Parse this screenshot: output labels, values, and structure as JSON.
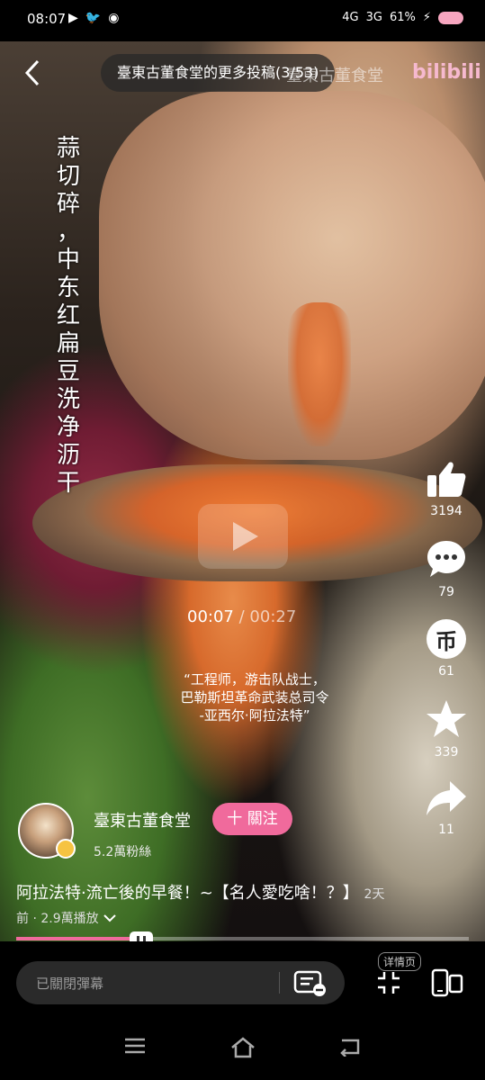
{
  "status_bar": {
    "time": "08:07",
    "network_1": "4G",
    "network_2": "3G",
    "battery": "61%"
  },
  "header": {
    "title": "臺東古董食堂的更多投稿(3/53)",
    "watermark": "臺東古董食堂",
    "logo": "bilibili"
  },
  "caption": {
    "chars": [
      "蒜",
      "切",
      "碎",
      "，",
      "中",
      "东",
      "红",
      "扁",
      "豆",
      "洗",
      "净",
      "沥",
      "干"
    ]
  },
  "player": {
    "current_time": "00:07",
    "separator": "/",
    "total_time": "00:27",
    "progress_fraction": 0.259
  },
  "quote": {
    "line1": "“工程师，游击队战士，",
    "line2": "巴勒斯坦革命武装总司令",
    "line3": "-亚西尔·阿拉法特”"
  },
  "actions": {
    "likes": "3194",
    "comments": "79",
    "coins": "61",
    "favorites": "339",
    "shares": "11",
    "coin_glyph": "币"
  },
  "uploader": {
    "name": "臺東古董食堂",
    "followers": "5.2萬粉絲",
    "follow_label": "十 關注"
  },
  "description": {
    "title": "阿拉法特·流亡後的早餐！~【名人愛吃啥！？】",
    "meta": "2天前 · 2.9萬播放"
  },
  "bottom": {
    "danmaku_placeholder": "已關閉彈幕",
    "detail_label": "详情页"
  },
  "colors": {
    "accent": "#f06a9c",
    "background": "#000000"
  }
}
